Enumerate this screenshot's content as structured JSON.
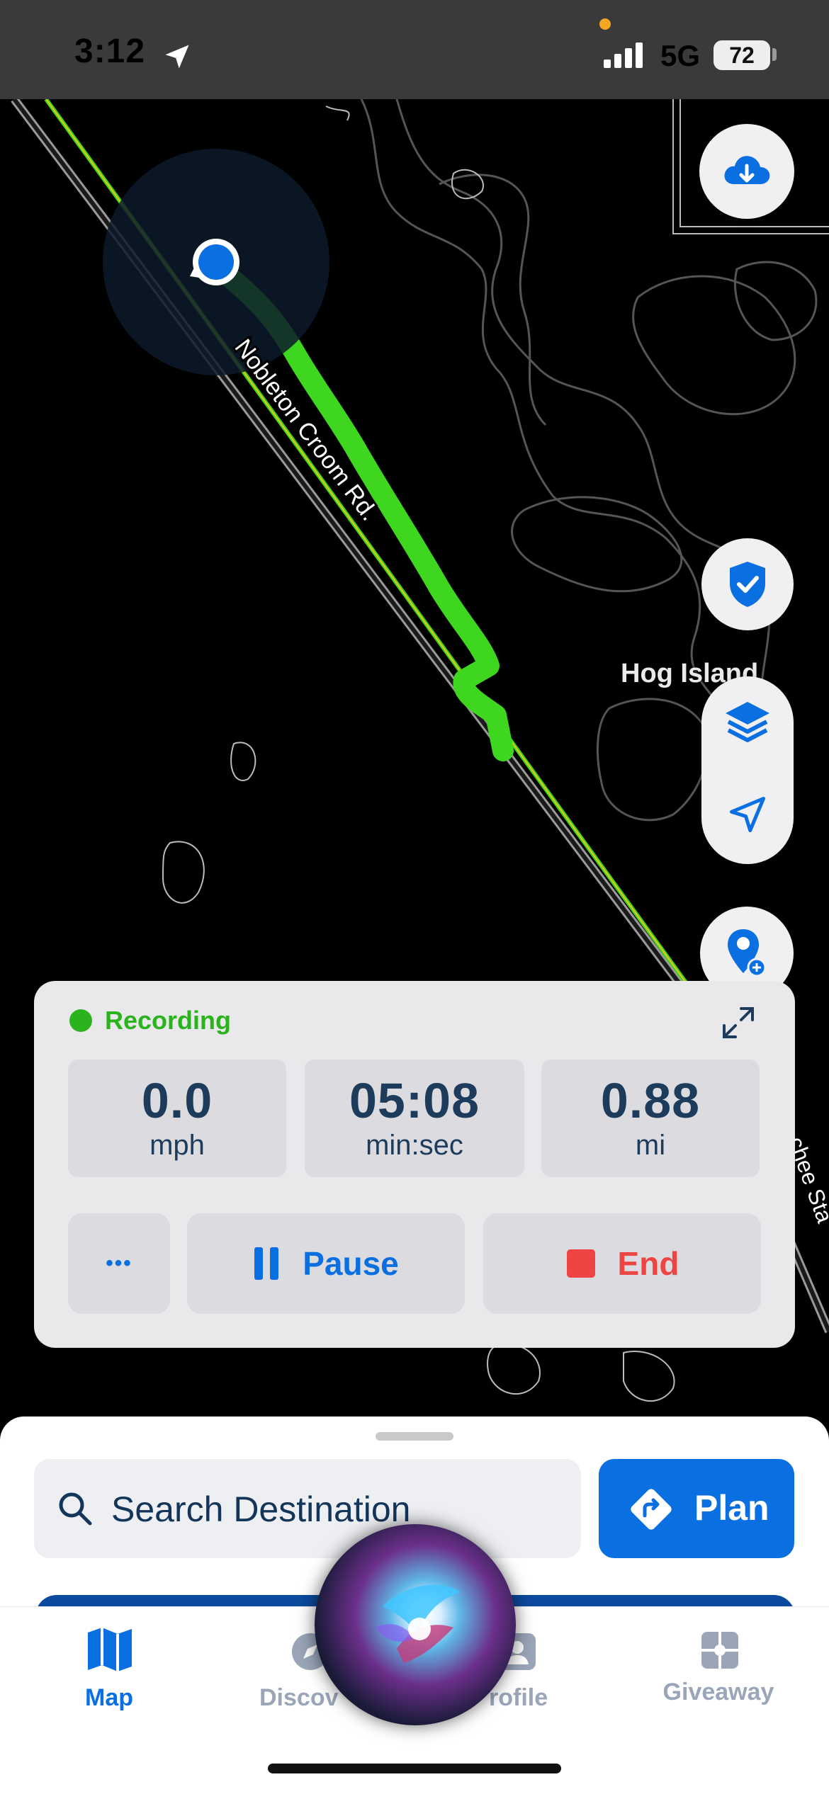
{
  "status_bar": {
    "time": "3:12",
    "network": "5G",
    "battery": "72",
    "icons": [
      "location-arrow-icon",
      "signal-bars-icon",
      "battery-icon",
      "privacy-dot"
    ]
  },
  "map": {
    "road_label": "Nobleton Croom Rd.",
    "place_label": "Hog Island",
    "edge_label_partial": "chee Sta",
    "colors": {
      "track": "#3fd61f",
      "road": "#b9b9b9",
      "user_dot": "#0a6fe0"
    }
  },
  "map_controls": {
    "download_icon": "cloud-download-icon",
    "shield_icon": "shield-check-icon",
    "layers_icon": "layers-icon",
    "locate_icon": "location-arrow-icon",
    "add_pin_icon": "add-pin-icon"
  },
  "recording": {
    "status": "Recording",
    "stats": [
      {
        "value": "0.0",
        "unit": "mph"
      },
      {
        "value": "05:08",
        "unit": "min:sec"
      },
      {
        "value": "0.88",
        "unit": "mi"
      }
    ],
    "more_label": "•••",
    "pause_label": "Pause",
    "end_label": "End",
    "colors": {
      "status": "#2bb31d",
      "pause": "#0a6fe0",
      "end": "#ef4444"
    }
  },
  "bottom_sheet": {
    "search_placeholder": "Search Destination",
    "plan_label": "Plan"
  },
  "tabs": [
    {
      "label": "Map",
      "icon": "map-icon",
      "active": true
    },
    {
      "label": "Discover",
      "icon": "compass-icon",
      "active": false
    },
    {
      "label": "Profile",
      "icon": "profile-icon",
      "active": false
    },
    {
      "label": "Giveaway",
      "icon": "gift-icon",
      "active": false
    }
  ],
  "tab_visible_text": {
    "discover": "Discov",
    "profile": "rofile"
  },
  "colors": {
    "accent": "#0a6fe0",
    "panel_text": "#1d3b5a"
  }
}
